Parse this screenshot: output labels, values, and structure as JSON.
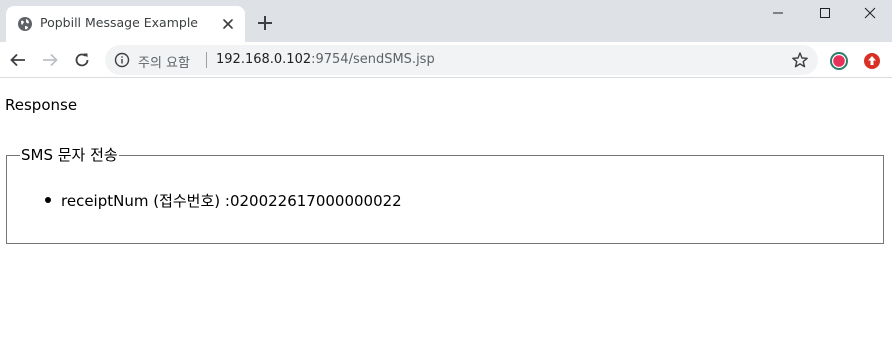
{
  "browser": {
    "tab": {
      "title": "Popbill Message Example"
    },
    "address": {
      "security_label": "주의 요함",
      "host": "192.168.0.102",
      "path": ":9754/sendSMS.jsp"
    },
    "icons": {
      "favicon": "globe-icon",
      "close": "close-icon",
      "new_tab": "plus-icon",
      "back": "arrow-left-icon",
      "forward": "arrow-right-icon",
      "reload": "reload-icon",
      "info": "info-icon",
      "bookmark": "star-icon",
      "extension_1": "record-extension-icon",
      "extension_2": "upload-extension-icon"
    },
    "colors": {
      "tabstrip_bg": "#dee1e6",
      "omnibox_bg": "#f1f3f4",
      "ext_1": "#e8315a",
      "ext_2": "#d93025"
    }
  },
  "page": {
    "heading": "Response",
    "fieldset": {
      "legend": "SMS 문자 전송",
      "items": [
        {
          "text": "receiptNum (접수번호) :020022617000000022"
        }
      ]
    }
  }
}
